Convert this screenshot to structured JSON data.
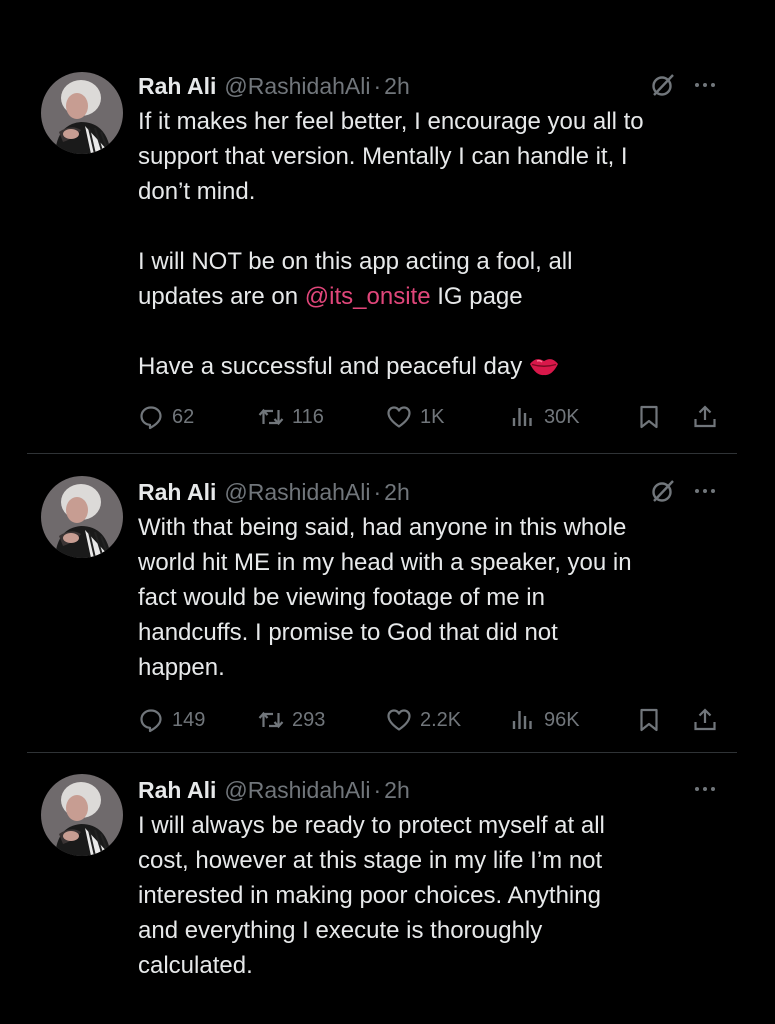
{
  "tweets": [
    {
      "author": {
        "name": "Rah Ali",
        "handle": "@RashidahAli",
        "separator": "·",
        "time": "2h"
      },
      "paragraphs": [
        "If it makes her feel better, I encourage you all to\nsupport that version. Mentally I can handle it, I\ndon’t mind.",
        "I will NOT be on this app acting a fool, all\nupdates are on ",
        "Have a successful and peaceful day"
      ],
      "mention": "@its_onsite",
      "after_mention": " IG page",
      "stats": {
        "replies": "62",
        "reposts": "116",
        "likes": "1K",
        "views": "30K"
      },
      "icons": [
        "grok-icon",
        "more-icon",
        "reply-icon",
        "repost-icon",
        "like-icon",
        "views-icon",
        "bookmark-icon",
        "share-icon",
        "kiss-lips-emoji"
      ]
    },
    {
      "author": {
        "name": "Rah Ali",
        "handle": "@RashidahAli",
        "separator": "·",
        "time": "2h"
      },
      "text": "With that being said, had anyone in this whole\nworld hit ME in my head with a speaker, you in\nfact would be viewing footage of me in\nhandcuffs. I promise to God that did not\nhappen.",
      "stats": {
        "replies": "149",
        "reposts": "293",
        "likes": "2.2K",
        "views": "96K"
      }
    },
    {
      "author": {
        "name": "Rah Ali",
        "handle": "@RashidahAli",
        "separator": "·",
        "time": "2h"
      },
      "text": "I will always be ready to protect myself at all\ncost, however at this stage in my life I’m not\ninterested in making poor choices. Anything\nand everything I execute is thoroughly\ncalculated."
    }
  ],
  "colors": {
    "background": "#000000",
    "text": "#e7e9ea",
    "muted": "#71767b",
    "mention": "#e0467a",
    "divider": "#2f3336"
  }
}
